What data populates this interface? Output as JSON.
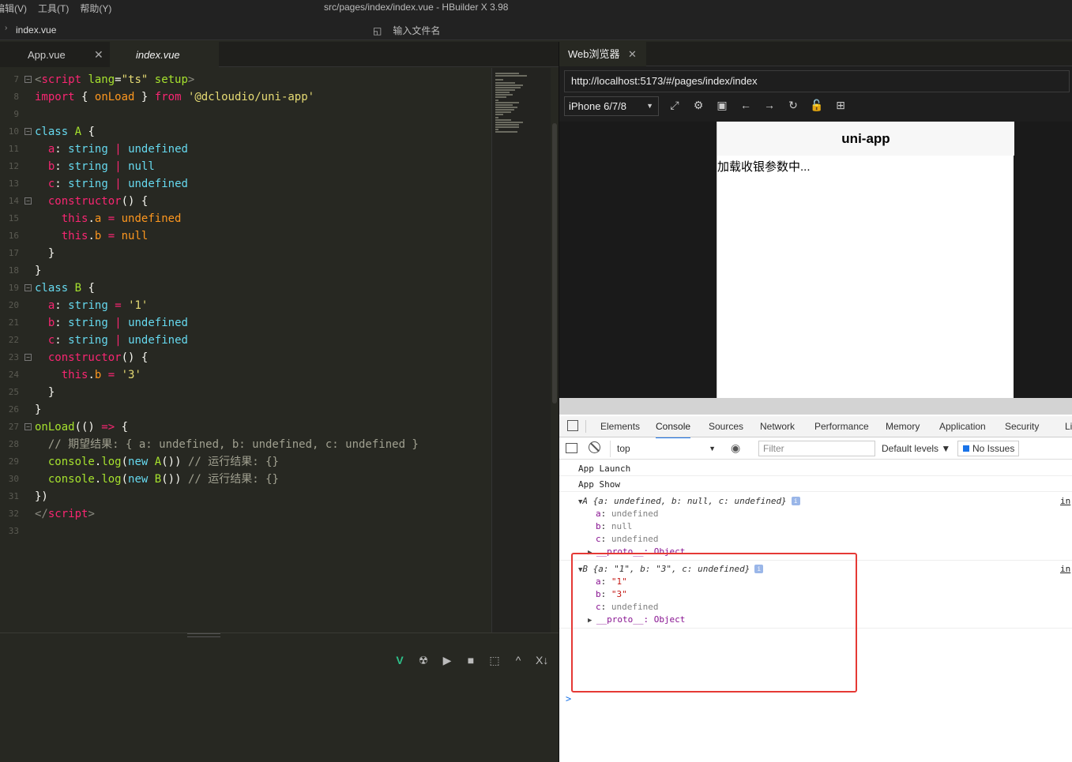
{
  "titlebar": {
    "menus": [
      "编辑(V)",
      "工具(T)",
      "帮助(Y)"
    ],
    "window_title": "src/pages/index/index.vue - HBuilder X 3.98"
  },
  "breadcrumb": {
    "file": "index.vue",
    "open_file_placeholder": "输入文件名"
  },
  "editor_tabs": [
    {
      "label": "App.vue",
      "active": false
    },
    {
      "label": "index.vue",
      "active": true
    }
  ],
  "code_lines": [
    {
      "n": "7",
      "fold": "⊟",
      "html": "<span class=\"gr\">&lt;</span><span class=\"kw2\">script</span> <span class=\"df\">lang</span><span class=\"pl\">=</span><span class=\"str\">\"ts\"</span> <span class=\"df\">setup</span><span class=\"gr\">&gt;</span>"
    },
    {
      "n": "8",
      "fold": "",
      "html": "<span class=\"kw2\">import</span> <span class=\"pl\">{</span> <span class=\"this\">onLoad</span> <span class=\"pl\">}</span> <span class=\"kw2\">from</span> <span class=\"str\">'@dcloudio/uni-app'</span>"
    },
    {
      "n": "9",
      "fold": "",
      "html": ""
    },
    {
      "n": "10",
      "fold": "⊟",
      "html": "<span class=\"kw\">class</span> <span class=\"df\">A</span> <span class=\"pl\">{</span>"
    },
    {
      "n": "11",
      "fold": "",
      "html": "  <span class=\"kw2\">a</span><span class=\"pl\">:</span> <span class=\"ty\">string</span> <span class=\"kw2\">|</span> <span class=\"ty\">undefined</span>"
    },
    {
      "n": "12",
      "fold": "",
      "html": "  <span class=\"kw2\">b</span><span class=\"pl\">:</span> <span class=\"ty\">string</span> <span class=\"kw2\">|</span> <span class=\"ty\">null</span>"
    },
    {
      "n": "13",
      "fold": "",
      "html": "  <span class=\"kw2\">c</span><span class=\"pl\">:</span> <span class=\"ty\">string</span> <span class=\"kw2\">|</span> <span class=\"ty\">undefined</span>"
    },
    {
      "n": "14",
      "fold": "⊟",
      "html": "  <span class=\"kw2\">constructor</span><span class=\"pl\">() {</span>"
    },
    {
      "n": "15",
      "fold": "",
      "html": "    <span class=\"kw2\">this</span><span class=\"pl\">.</span><span class=\"this\">a</span> <span class=\"kw2\">=</span> <span class=\"this\">undefined</span>"
    },
    {
      "n": "16",
      "fold": "",
      "html": "    <span class=\"kw2\">this</span><span class=\"pl\">.</span><span class=\"this\">b</span> <span class=\"kw2\">=</span> <span class=\"this\">null</span>"
    },
    {
      "n": "17",
      "fold": "",
      "html": "  <span class=\"pl\">}</span>"
    },
    {
      "n": "18",
      "fold": "",
      "html": "<span class=\"pl\">}</span>"
    },
    {
      "n": "19",
      "fold": "⊟",
      "html": "<span class=\"kw\">class</span> <span class=\"df\">B</span> <span class=\"pl\">{</span>"
    },
    {
      "n": "20",
      "fold": "",
      "html": "  <span class=\"kw2\">a</span><span class=\"pl\">:</span> <span class=\"ty\">string</span> <span class=\"kw2\">=</span> <span class=\"str\">'1'</span>"
    },
    {
      "n": "21",
      "fold": "",
      "html": "  <span class=\"kw2\">b</span><span class=\"pl\">:</span> <span class=\"ty\">string</span> <span class=\"kw2\">|</span> <span class=\"ty\">undefined</span>"
    },
    {
      "n": "22",
      "fold": "",
      "html": "  <span class=\"kw2\">c</span><span class=\"pl\">:</span> <span class=\"ty\">string</span> <span class=\"kw2\">|</span> <span class=\"ty\">undefined</span>"
    },
    {
      "n": "23",
      "fold": "⊟",
      "html": "  <span class=\"kw2\">constructor</span><span class=\"pl\">() {</span>"
    },
    {
      "n": "24",
      "fold": "",
      "html": "    <span class=\"kw2\">this</span><span class=\"pl\">.</span><span class=\"this\">b</span> <span class=\"kw2\">=</span> <span class=\"str\">'3'</span>"
    },
    {
      "n": "25",
      "fold": "",
      "html": "  <span class=\"pl\">}</span>"
    },
    {
      "n": "26",
      "fold": "",
      "html": "<span class=\"pl\">}</span>"
    },
    {
      "n": "27",
      "fold": "⊟",
      "html": "<span class=\"df\">onLoad</span><span class=\"pl\">(() </span><span class=\"kw2\">=&gt;</span><span class=\"pl\"> {</span>"
    },
    {
      "n": "28",
      "fold": "",
      "html": "  <span class=\"cm\">// 期望结果: { a: undefined, b: undefined, c: undefined }</span>"
    },
    {
      "n": "29",
      "fold": "",
      "html": "  <span class=\"df\">console</span><span class=\"pl\">.</span><span class=\"df\">log</span><span class=\"pl\">(</span><span class=\"kw\">new</span> <span class=\"df\">A</span><span class=\"pl\">())</span> <span class=\"cm\">// 运行结果: {}</span>"
    },
    {
      "n": "30",
      "fold": "",
      "html": "  <span class=\"df\">console</span><span class=\"pl\">.</span><span class=\"df\">log</span><span class=\"pl\">(</span><span class=\"kw\">new</span> <span class=\"df\">B</span><span class=\"pl\">())</span> <span class=\"cm\">// 运行结果: {}</span>"
    },
    {
      "n": "31",
      "fold": "",
      "html": "<span class=\"pl\">})</span>"
    },
    {
      "n": "32",
      "fold": "",
      "html": "<span class=\"gr\">&lt;/</span><span class=\"kw2\">script</span><span class=\"gr\">&gt;</span>"
    },
    {
      "n": "33",
      "fold": "",
      "html": ""
    }
  ],
  "bottom_tools": [
    "V",
    "☢",
    "▶",
    "■",
    "⬚",
    "^",
    "X↓"
  ],
  "browser": {
    "tab_label": "Web浏览器",
    "url": "http://localhost:5173/#/pages/index/index",
    "device": "iPhone 6/7/8",
    "nav_icons": [
      "⤢",
      "⚙",
      "▣",
      "←",
      "→",
      "↻",
      "🔓",
      "⊞"
    ],
    "page_title": "uni-app",
    "page_text": "加载收银参数中..."
  },
  "devtools": {
    "tabs": [
      "Elements",
      "Console",
      "Sources",
      "Network",
      "Performance",
      "Memory",
      "Application",
      "Security",
      "Li"
    ],
    "active_tab": "Console",
    "context": "top",
    "filter_placeholder": "Filter",
    "levels": "Default levels ▼",
    "issues": "No Issues",
    "logs": [
      "App Launch",
      "App Show"
    ],
    "objects": [
      {
        "header": "A {a: undefined, b: null, c: undefined}",
        "props": [
          {
            "key": "a",
            "value": "undefined",
            "kind": "undef"
          },
          {
            "key": "b",
            "value": "null",
            "kind": "null"
          },
          {
            "key": "c",
            "value": "undefined",
            "kind": "undef"
          }
        ],
        "proto": "__proto__: Object",
        "source": "in"
      },
      {
        "header": "B {a: \"1\", b: \"3\", c: undefined}",
        "props": [
          {
            "key": "a",
            "value": "\"1\"",
            "kind": "str"
          },
          {
            "key": "b",
            "value": "\"3\"",
            "kind": "str"
          },
          {
            "key": "c",
            "value": "undefined",
            "kind": "undef"
          }
        ],
        "proto": "__proto__: Object",
        "source": "in"
      }
    ],
    "prompt": ">"
  },
  "colors": {
    "highlight_box": "#e53935",
    "active_tab_underline": "#1a73e8"
  }
}
